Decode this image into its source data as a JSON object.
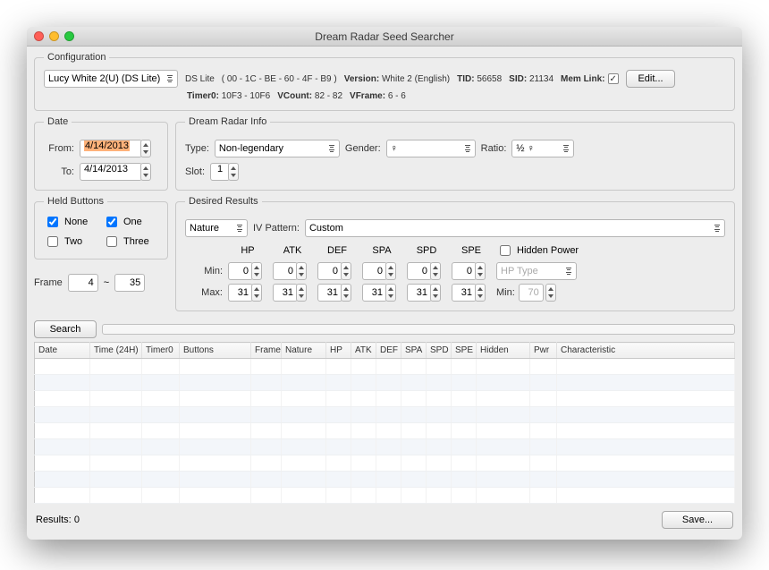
{
  "window": {
    "title": "Dream Radar Seed Searcher"
  },
  "configuration": {
    "legend": "Configuration",
    "profile_select": "Lucy White 2(U) (DS Lite)",
    "ds_label": "DS Lite",
    "mac": "( 00 - 1C - BE - 60 - 4F - B9 )",
    "version_label": "Version:",
    "version_value": "White 2 (English)",
    "tid_label": "TID:",
    "tid_value": "56658",
    "sid_label": "SID:",
    "sid_value": "21134",
    "memlink_label": "Mem Link:",
    "edit_btn": "Edit...",
    "timer0_label": "Timer0:",
    "timer0_value": "10F3 - 10F6",
    "vcount_label": "VCount:",
    "vcount_value": "82 - 82",
    "vframe_label": "VFrame:",
    "vframe_value": "6 - 6"
  },
  "date": {
    "legend": "Date",
    "from_label": "From:",
    "from_value": "4/14/2013",
    "to_label": "To:",
    "to_value": "4/14/2013"
  },
  "dream": {
    "legend": "Dream Radar Info",
    "type_label": "Type:",
    "type_value": "Non-legendary",
    "gender_label": "Gender:",
    "gender_value": "♀",
    "ratio_label": "Ratio:",
    "ratio_value": "½ ♀",
    "slot_label": "Slot:",
    "slot_value": "1"
  },
  "held": {
    "legend": "Held Buttons",
    "none": "None",
    "one": "One",
    "two": "Two",
    "three": "Three",
    "none_checked": true,
    "one_checked": true,
    "two_checked": false,
    "three_checked": false,
    "frame_label": "Frame",
    "frame_min": "4",
    "frame_sep": "~",
    "frame_max": "35"
  },
  "desired": {
    "legend": "Desired Results",
    "nature_label": "Nature",
    "ivpattern_label": "IV Pattern:",
    "ivpattern_value": "Custom",
    "headers": {
      "hp": "HP",
      "atk": "ATK",
      "def": "DEF",
      "spa": "SPA",
      "spd": "SPD",
      "spe": "SPE"
    },
    "min_label": "Min:",
    "max_label": "Max:",
    "min": {
      "hp": "0",
      "atk": "0",
      "def": "0",
      "spa": "0",
      "spd": "0",
      "spe": "0"
    },
    "max": {
      "hp": "31",
      "atk": "31",
      "def": "31",
      "spa": "31",
      "spd": "31",
      "spe": "31"
    },
    "hidden_power_label": "Hidden Power",
    "hp_type_placeholder": "HP Type",
    "hp_min_label": "Min:",
    "hp_min_value": "70"
  },
  "search": {
    "btn": "Search"
  },
  "columns": {
    "date": "Date",
    "time": "Time (24H)",
    "timer0": "Timer0",
    "buttons": "Buttons",
    "frame": "Frame",
    "nature": "Nature",
    "hp": "HP",
    "atk": "ATK",
    "def": "DEF",
    "spa": "SPA",
    "spd": "SPD",
    "spe": "SPE",
    "hidden": "Hidden",
    "pwr": "Pwr",
    "char": "Characteristic"
  },
  "footer": {
    "results_label": "Results:",
    "results_count": "0",
    "save_btn": "Save..."
  }
}
